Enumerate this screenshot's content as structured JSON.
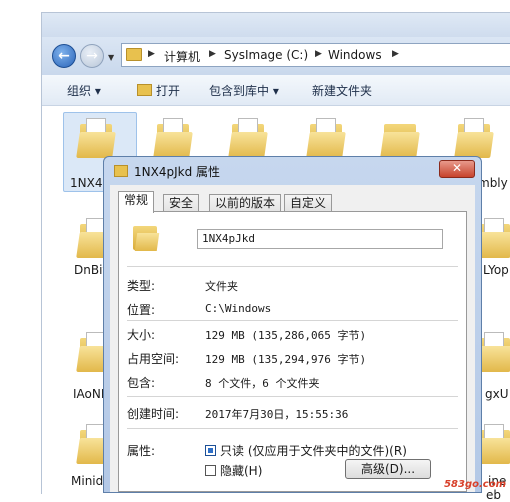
{
  "explorer": {
    "breadcrumb": [
      "计算机",
      "SysImage (C:)",
      "Windows"
    ],
    "toolbar": {
      "organize": "组织 ▾",
      "open": "打开",
      "include_in_library": "包含到库中 ▾",
      "new_folder": "新建文件夹"
    },
    "folders": [
      {
        "label": "1NX4p"
      },
      {
        "label": "DnBiv"
      },
      {
        "label": "IAoNI"
      },
      {
        "label": "Minid"
      },
      {
        "label": "mbly"
      },
      {
        "label": "LYop"
      },
      {
        "label": "gxU"
      },
      {
        "label": "ine"
      },
      {
        "label": "eb"
      }
    ]
  },
  "dialog": {
    "title": "1NX4pJkd 属性",
    "close_label": "✕",
    "tabs": [
      "常规",
      "安全",
      "以前的版本",
      "自定义"
    ],
    "name_value": "1NX4pJkd",
    "rows": [
      {
        "label": "类型:",
        "value": "文件夹"
      },
      {
        "label": "位置:",
        "value": "C:\\Windows"
      },
      {
        "label": "大小:",
        "value": "129 MB (135,286,065 字节)"
      },
      {
        "label": "占用空间:",
        "value": "129 MB (135,294,976 字节)"
      },
      {
        "label": "包含:",
        "value": "8 个文件，6 个文件夹"
      },
      {
        "label": "创建时间:",
        "value": "2017年7月30日，15:55:36"
      }
    ],
    "attributes_label": "属性:",
    "readonly_label": "只读 (仅应用于文件夹中的文件)(R)",
    "readonly_checked": true,
    "hidden_label": "隐藏(H)",
    "hidden_checked": false,
    "advanced_label": "高级(D)..."
  },
  "watermark": "583go.com"
}
